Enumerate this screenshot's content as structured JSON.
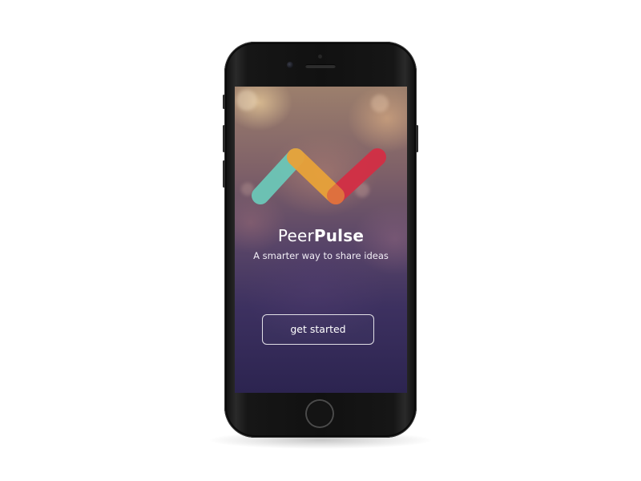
{
  "app": {
    "name_light": "Peer",
    "name_bold": "Pulse",
    "tagline": "A smarter way to share ideas"
  },
  "cta": {
    "label": "get started"
  },
  "logo": {
    "icon": "pulse-zigzag-logo",
    "colors": [
      "#6cc7b8",
      "#e8a23a",
      "#d32f45"
    ]
  },
  "theme": {
    "phone_color": "#111111",
    "button_border": "#ffffff",
    "text_color": "#ffffff"
  }
}
